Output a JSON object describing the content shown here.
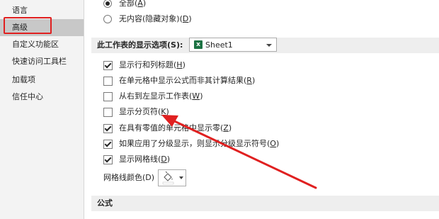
{
  "sidebar": {
    "items": [
      {
        "label": "语言"
      },
      {
        "label": "高级"
      },
      {
        "label": "自定义功能区"
      },
      {
        "label": "快速访问工具栏"
      },
      {
        "label": "加载项"
      },
      {
        "label": "信任中心"
      }
    ]
  },
  "objects_group": {
    "all": {
      "text": "全部",
      "key": "A"
    },
    "none": {
      "text": "无内容(隐藏对象)",
      "key": "D"
    }
  },
  "worksheet_section": {
    "label": "此工作表的显示选项(S):",
    "sheet_selected": "Sheet1",
    "options": [
      {
        "text": "显示行和列标题",
        "key": "H",
        "checked": true
      },
      {
        "text": "在单元格中显示公式而非其计算结果",
        "key": "R",
        "checked": false
      },
      {
        "text": "从右到左显示工作表",
        "key": "W",
        "checked": false
      },
      {
        "text": "显示分页符",
        "key": "K",
        "checked": false
      },
      {
        "text": "在具有零值的单元格中显示零",
        "key": "Z",
        "checked": true
      },
      {
        "text": "如果应用了分级显示，则显示分级显示符号",
        "key": "O",
        "checked": true
      },
      {
        "text": "显示网格线",
        "key": "D",
        "checked": true
      }
    ],
    "gridline_color_label": "网格线颜色(D)"
  },
  "formulas_section": {
    "title": "公式"
  },
  "colors": {
    "highlight_red": "#e02020",
    "arrow_red": "#e02020",
    "excel_green": "#1d7344"
  },
  "icons": {
    "sheet": "excel-sheet-icon",
    "paint": "paint-bucket-icon"
  }
}
